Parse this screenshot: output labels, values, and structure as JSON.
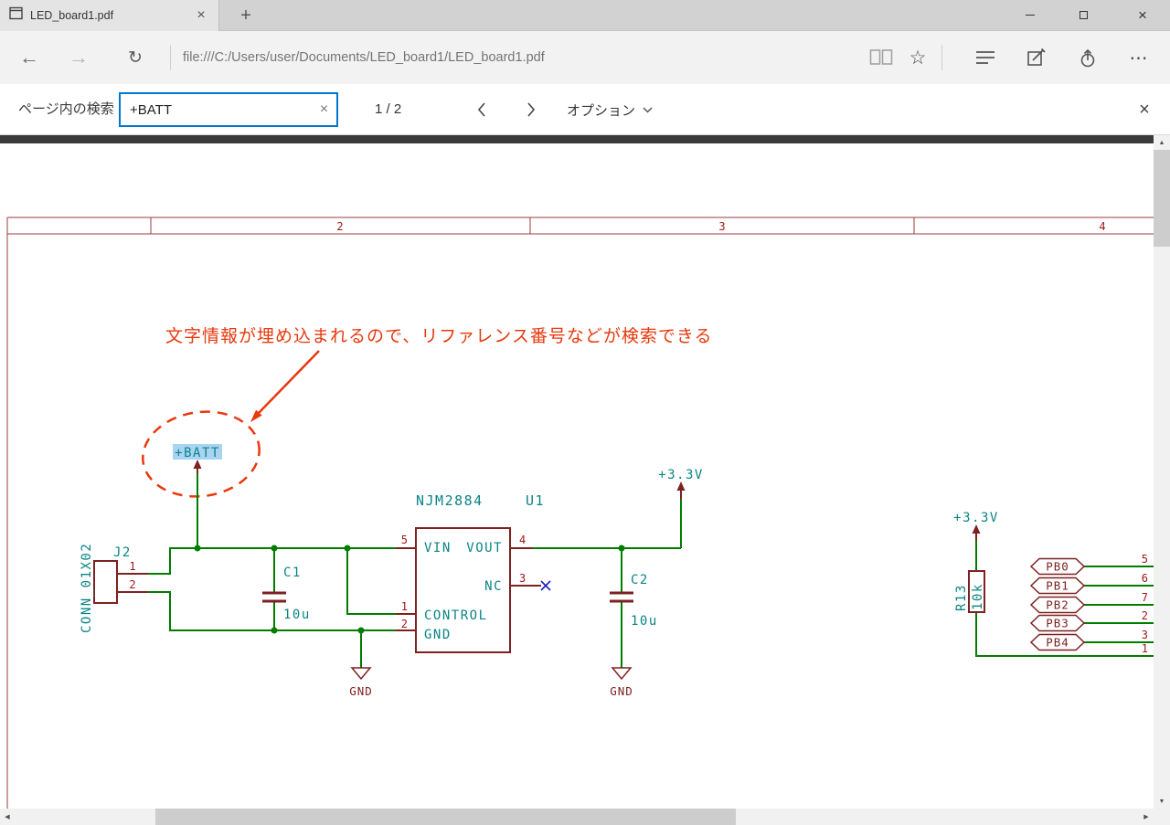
{
  "window": {
    "tab_title": "LED_board1.pdf"
  },
  "nav": {
    "url": "file:///C:/Users/user/Documents/LED_board1/LED_board1.pdf"
  },
  "find": {
    "label": "ページ内の検索",
    "query": "+BATT",
    "count": "1 / 2",
    "options": "オプション"
  },
  "icons": {
    "back": "←",
    "forward": "→",
    "refresh": "↻",
    "star": "☆",
    "more": "⋯",
    "new_tab": "+",
    "close": "×",
    "scroll_up": "▲",
    "scroll_down": "▼",
    "scroll_left": "◀",
    "scroll_right": "▶"
  },
  "colors": {
    "accent_blue": "#0076d1",
    "wire_green": "#007d00",
    "component_maroon": "#7d2121",
    "pin_red": "#a01818",
    "field_teal": "#0b8484",
    "annotation_red": "#e8380d",
    "search_highlight": "#a8d3f2"
  },
  "pdf": {
    "annotation": "文字情報が埋め込まれるので、リファレンス番号などが検索できる",
    "sheet_cols": [
      "2",
      "3",
      "4"
    ],
    "batt_label": "+BATT",
    "v33_label": "+3.3V",
    "gnd_label": "GND",
    "j2": {
      "ref": "J2",
      "value": "CONN_01X02",
      "pin1": "1",
      "pin2": "2"
    },
    "c1": {
      "ref": "C1",
      "value": "10u"
    },
    "c2": {
      "ref": "C2",
      "value": "10u"
    },
    "u1": {
      "ref": "U1",
      "value": "NJM2884",
      "vin": "VIN",
      "vout": "VOUT",
      "nc": "NC",
      "control": "CONTROL",
      "gnd": "GND",
      "n_vin": "5",
      "n_vout": "4",
      "n_nc": "3",
      "n_control": "1",
      "n_gnd": "2"
    },
    "r13": {
      "ref": "R13",
      "value": "10k"
    },
    "labels": [
      "PB0",
      "PB1",
      "PB2",
      "PB3",
      "PB4"
    ],
    "edge_pins": [
      "5",
      "6",
      "7",
      "2",
      "3",
      "1"
    ]
  }
}
